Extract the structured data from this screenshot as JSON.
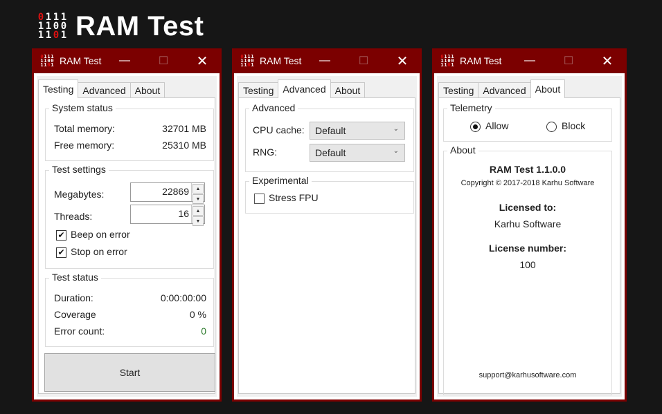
{
  "hero": {
    "title": "RAM Test",
    "logo_rows": [
      "0111",
      "1100",
      "1101"
    ]
  },
  "windows": [
    {
      "title": "RAM Test",
      "tabs": [
        "Testing",
        "Advanced",
        "About"
      ],
      "active_tab": "Testing",
      "system_status": {
        "legend": "System status",
        "total_label": "Total memory:",
        "total_value": "32701 MB",
        "free_label": "Free memory:",
        "free_value": "25310 MB"
      },
      "test_settings": {
        "legend": "Test settings",
        "megabytes_label": "Megabytes:",
        "megabytes_value": "22869",
        "threads_label": "Threads:",
        "threads_value": "16",
        "beep_label": "Beep on error",
        "beep_checked": true,
        "stop_label": "Stop on error",
        "stop_checked": true
      },
      "test_status": {
        "legend": "Test status",
        "duration_label": "Duration:",
        "duration_value": "0:00:00:00",
        "coverage_label": "Coverage",
        "coverage_value": "0 %",
        "errors_label": "Error count:",
        "errors_value": "0"
      },
      "start_label": "Start"
    },
    {
      "title": "RAM Test",
      "tabs": [
        "Testing",
        "Advanced",
        "About"
      ],
      "active_tab": "Advanced",
      "advanced": {
        "legend": "Advanced",
        "cpu_label": "CPU cache:",
        "cpu_value": "Default",
        "rng_label": "RNG:",
        "rng_value": "Default"
      },
      "experimental": {
        "legend": "Experimental",
        "stress_label": "Stress FPU",
        "stress_checked": false
      }
    },
    {
      "title": "RAM Test",
      "tabs": [
        "Testing",
        "Advanced",
        "About"
      ],
      "active_tab": "About",
      "telemetry": {
        "legend": "Telemetry",
        "allow_label": "Allow",
        "block_label": "Block",
        "selected": "Allow"
      },
      "about": {
        "legend": "About",
        "product": "RAM Test 1.1.0.0",
        "copyright": "Copyright © 2017-2018 Karhu Software",
        "licensed_to_label": "Licensed to:",
        "licensed_to_value": "Karhu Software",
        "license_number_label": "License number:",
        "license_number_value": "100",
        "support_email": "support@karhusoftware.com"
      }
    }
  ],
  "colors": {
    "titlebar": "#7b0000",
    "background": "#161616",
    "logo_red": "#dd1111",
    "error_count_green": "#2a7a2a"
  }
}
